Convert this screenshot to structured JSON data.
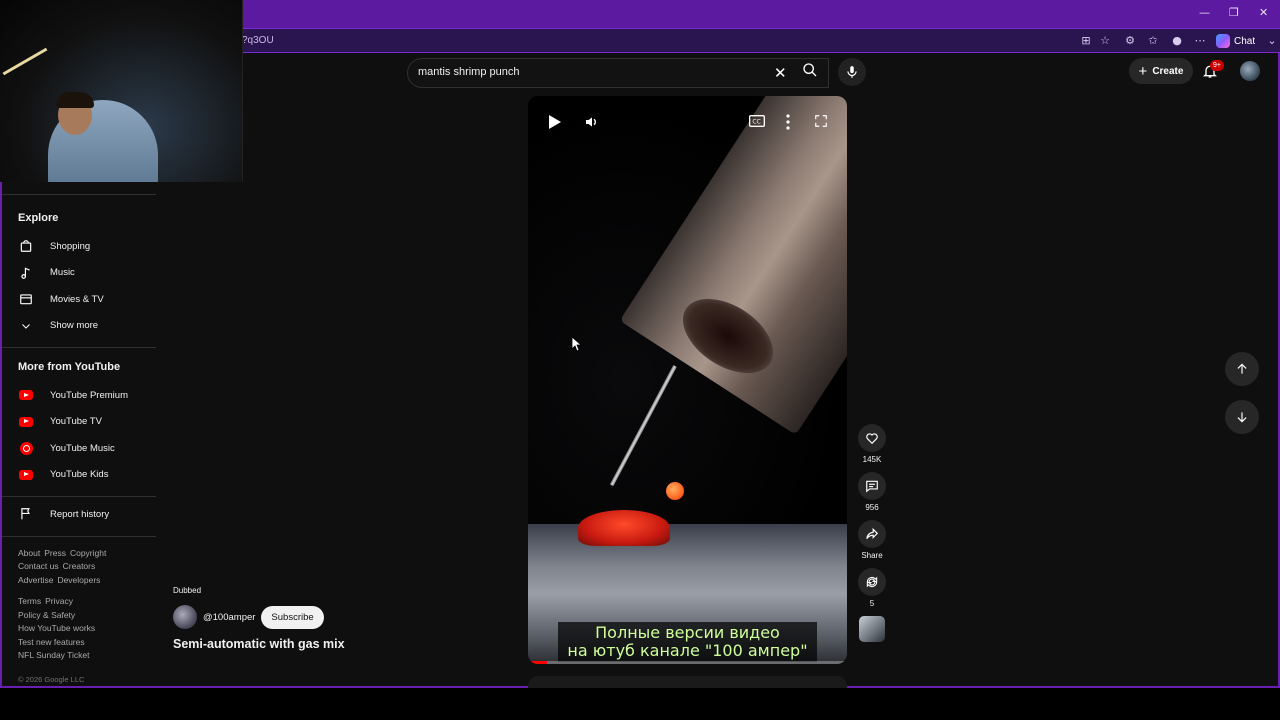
{
  "browser": {
    "url_fragment": "?q3OU",
    "chat_label": "Chat",
    "window_controls": [
      "minimize-icon",
      "restore-icon",
      "close-icon"
    ]
  },
  "search": {
    "query": "mantis shrimp punch"
  },
  "header": {
    "create_label": "Create",
    "notification_badge": "9+"
  },
  "sidebar": {
    "explore_heading": "Explore",
    "explore_items": [
      {
        "label": "Shopping",
        "icon": "shopping-bag-icon"
      },
      {
        "label": "Music",
        "icon": "music-note-icon"
      },
      {
        "label": "Movies & TV",
        "icon": "clapperboard-icon"
      },
      {
        "label": "Show more",
        "icon": "chevron-down-icon"
      }
    ],
    "more_heading": "More from YouTube",
    "more_items": [
      {
        "label": "YouTube Premium",
        "icon": "youtube-premium-icon"
      },
      {
        "label": "YouTube TV",
        "icon": "youtube-tv-icon"
      },
      {
        "label": "YouTube Music",
        "icon": "youtube-music-icon"
      },
      {
        "label": "YouTube Kids",
        "icon": "youtube-kids-icon"
      }
    ],
    "report_history": "Report history",
    "footer_row1": [
      "About",
      "Press",
      "Copyright"
    ],
    "footer_row2": [
      "Contact us",
      "Creators"
    ],
    "footer_row3": [
      "Advertise",
      "Developers"
    ],
    "footer_row4": [
      "Terms",
      "Privacy"
    ],
    "footer_row5": [
      "Policy & Safety"
    ],
    "footer_row6": [
      "How YouTube works"
    ],
    "footer_row7": [
      "Test new features"
    ],
    "footer_row8": [
      "NFL Sunday Ticket"
    ],
    "copyright": "© 2026 Google LLC"
  },
  "video": {
    "subtitle_line1": "Полные версии видео",
    "subtitle_line2": "на ютуб канале  \"100 ампер\"",
    "progress": 0.06
  },
  "actions": {
    "likes": "145K",
    "comments": "956",
    "share": "Share",
    "remix": "5"
  },
  "short_info": {
    "dubbed": "Dubbed",
    "channel": "@100amper",
    "subscribe": "Subscribe",
    "title": "Semi-automatic with gas mix"
  }
}
